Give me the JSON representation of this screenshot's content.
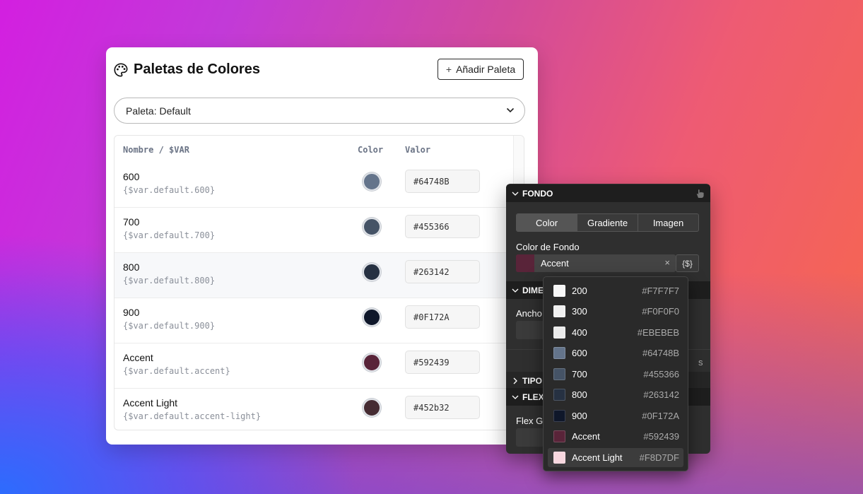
{
  "palette_card": {
    "title": "Paletas de Colores",
    "add_button": "Añadir Paleta",
    "select_value": "Paleta: Default",
    "columns": {
      "name": "Nombre / $VAR",
      "color": "Color",
      "value": "Valor"
    },
    "rows": [
      {
        "name": "600",
        "var": "{$var.default.600}",
        "value": "#64748B",
        "color": "#64748B"
      },
      {
        "name": "700",
        "var": "{$var.default.700}",
        "value": "#455366",
        "color": "#455366"
      },
      {
        "name": "800",
        "var": "{$var.default.800}",
        "value": "#263142",
        "color": "#263142"
      },
      {
        "name": "900",
        "var": "{$var.default.900}",
        "value": "#0F172A",
        "color": "#0F172A"
      },
      {
        "name": "Accent",
        "var": "{$var.default.accent}",
        "value": "#592439",
        "color": "#592439"
      },
      {
        "name": "Accent Light",
        "var": "{$var.default.accent-light}",
        "value": "#452b32",
        "color": "#452b32"
      }
    ]
  },
  "style_panel": {
    "sections": {
      "fondo": "FONDO",
      "dimensions": "DIME",
      "typography": "TIPO",
      "flex": "FLEX"
    },
    "bg_tabs": [
      "Color",
      "Gradiente",
      "Imagen"
    ],
    "active_tab": "Color",
    "bg_color_label": "Color de Fondo",
    "bg_color_value": "Accent",
    "bg_color_hex": "#592439",
    "clear_symbol": "×",
    "var_button": "{$}",
    "width_label": "Ancho",
    "flex_grow_label": "Flex G",
    "partial_s": "s"
  },
  "dropdown": {
    "selected": "Accent Light",
    "items": [
      {
        "name": "200",
        "hex": "#F7F7F7"
      },
      {
        "name": "300",
        "hex": "#F0F0F0"
      },
      {
        "name": "400",
        "hex": "#EBEBEB"
      },
      {
        "name": "600",
        "hex": "#64748B"
      },
      {
        "name": "700",
        "hex": "#455366"
      },
      {
        "name": "800",
        "hex": "#263142"
      },
      {
        "name": "900",
        "hex": "#0F172A"
      },
      {
        "name": "Accent",
        "hex": "#592439"
      },
      {
        "name": "Accent Light",
        "hex": "#F8D7DF"
      }
    ]
  }
}
